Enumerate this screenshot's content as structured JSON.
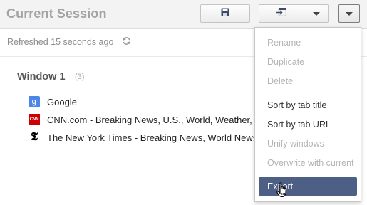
{
  "header": {
    "title": "Current Session",
    "save_icon": "floppy-disk-icon",
    "open_icon": "open-in-window-icon",
    "caret_icon": "chevron-down-icon",
    "menu_icon": "chevron-down-icon"
  },
  "subheader": {
    "refresh_text": "Refreshed 15 seconds ago",
    "refresh_icon": "refresh-icon"
  },
  "window": {
    "title": "Window 1",
    "count": "(3)",
    "tabs": [
      {
        "favicon": "google-favicon",
        "favicon_text": "g",
        "title": "Google"
      },
      {
        "favicon": "cnn-favicon",
        "favicon_text": "CNN",
        "title": "CNN.com - Breaking News, U.S., World, Weather, "
      },
      {
        "favicon": "nyt-favicon",
        "favicon_text": "𝕿",
        "title": "The New York Times - Breaking News, World News"
      }
    ]
  },
  "menu": {
    "items": [
      {
        "label": "Rename",
        "state": "disabled"
      },
      {
        "label": "Duplicate",
        "state": "disabled"
      },
      {
        "label": "Delete",
        "state": "disabled"
      },
      {
        "label": "Sort by tab title",
        "state": "enabled"
      },
      {
        "label": "Sort by tab URL",
        "state": "enabled"
      },
      {
        "label": "Unify windows",
        "state": "disabled"
      },
      {
        "label": "Overwrite with current",
        "state": "disabled"
      },
      {
        "label": "Export",
        "state": "active"
      }
    ]
  },
  "colors": {
    "menu_highlight": "#4d5f85",
    "disabled_text": "#b4b4b4",
    "cnn_red": "#cc0000",
    "google_blue": "#4b86e8"
  }
}
